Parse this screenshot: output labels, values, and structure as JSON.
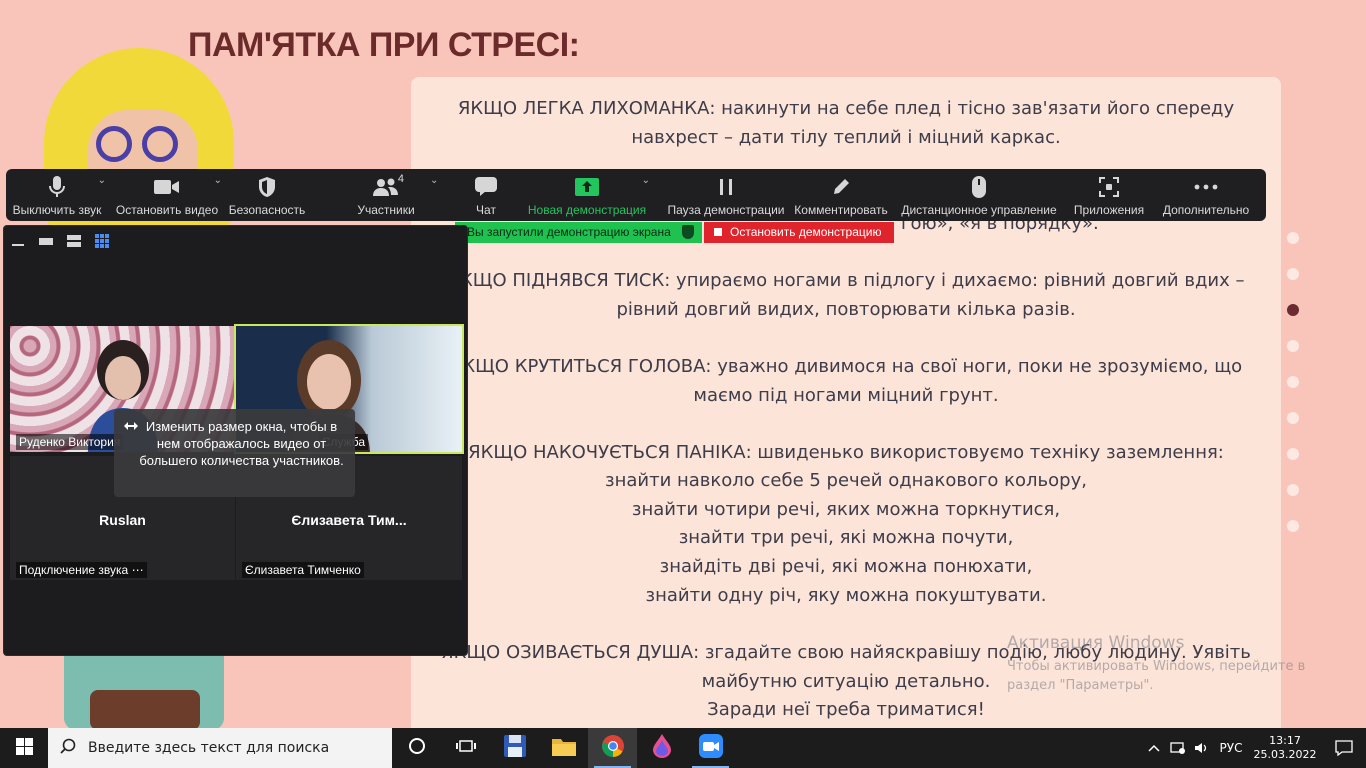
{
  "slide": {
    "title": "ПАМ'ЯТКА ПРИ СТРЕСІ:",
    "blocks": [
      "ЯКЩО ЛЕГКА ЛИХОМАНКА: накинути на себе плед і тісно зав'язати його спереду навхрест – дати тілу теплий і міцний каркас.",
      "ЯКЩО ПІДНЯВСЯ ТИСК: упираємо ногами в підлогу і дихаємо: рівний довгий вдих – рівний довгий видих, повторювати кілька разів.",
      "ЯКЩО КРУТИТЬСЯ ГОЛОВА: уважно дивимося на свої ноги, поки не зрозуміємо, що маємо під ногами міцний грунт.",
      "ЯКЩО НАКОЧУЄТЬСЯ ПАНІКА: швиденько використовуємо техніку заземлення:",
      "знайти навколо себе 5 речей однакового кольору,",
      "знайти чотири речі, яких можна торкнутися,",
      "знайти три речі, які можна почути,",
      "знайдіть дві речі, які можна понюхати,",
      "знайти одну річ, яку можна покуштувати.",
      "ЯКЩО ОЗИВАЄТЬСЯ ДУША: згадайте свою найяскравішу подію, любу людину. Уявіть майбутню ситуацію детально.",
      "Заради неї треба триматися!"
    ],
    "partial_line": "гою», «я в порядку».",
    "dots_count": 9,
    "active_dot": 2,
    "colors": {
      "background": "#f9c5ba",
      "card": "#fde4d8",
      "title": "#6b2b2b"
    }
  },
  "toolbar": {
    "mute": "Выключить звук",
    "stop_video": "Остановить видео",
    "security": "Безопасность",
    "participants": "Участники",
    "participants_count": "4",
    "chat": "Чат",
    "new_share": "Новая демонстрация",
    "pause_share": "Пауза демонстрации",
    "annotate": "Комментировать",
    "remote_control": "Дистанционное управление",
    "apps": "Приложения",
    "more": "Дополнительно"
  },
  "share_bar": {
    "status": "Вы запустили демонстрацию экрана",
    "stop": "Остановить демонстрацию"
  },
  "gallery": {
    "tiles": [
      {
        "name": "Руденко  Виктория",
        "center": ""
      },
      {
        "name": "Служба",
        "center": ""
      },
      {
        "name": "Подключение звука",
        "center": "Ruslan"
      },
      {
        "name": "Єлизавета Тимченко",
        "center": "Єлизавета  Тим..."
      }
    ],
    "tooltip": "Изменить размер окна, чтобы в нем отображалось видео от большего количества участников."
  },
  "watermark": {
    "title": "Активация Windows",
    "text": "Чтобы активировать Windows, перейдите в раздел \"Параметры\"."
  },
  "taskbar": {
    "search_placeholder": "Введите здесь текст для поиска",
    "apps": [
      "task-view",
      "widgets",
      "save-app",
      "file-explorer",
      "chrome",
      "paint",
      "zoom"
    ],
    "language": "РУС",
    "time": "13:17",
    "date": "25.03.2022"
  }
}
